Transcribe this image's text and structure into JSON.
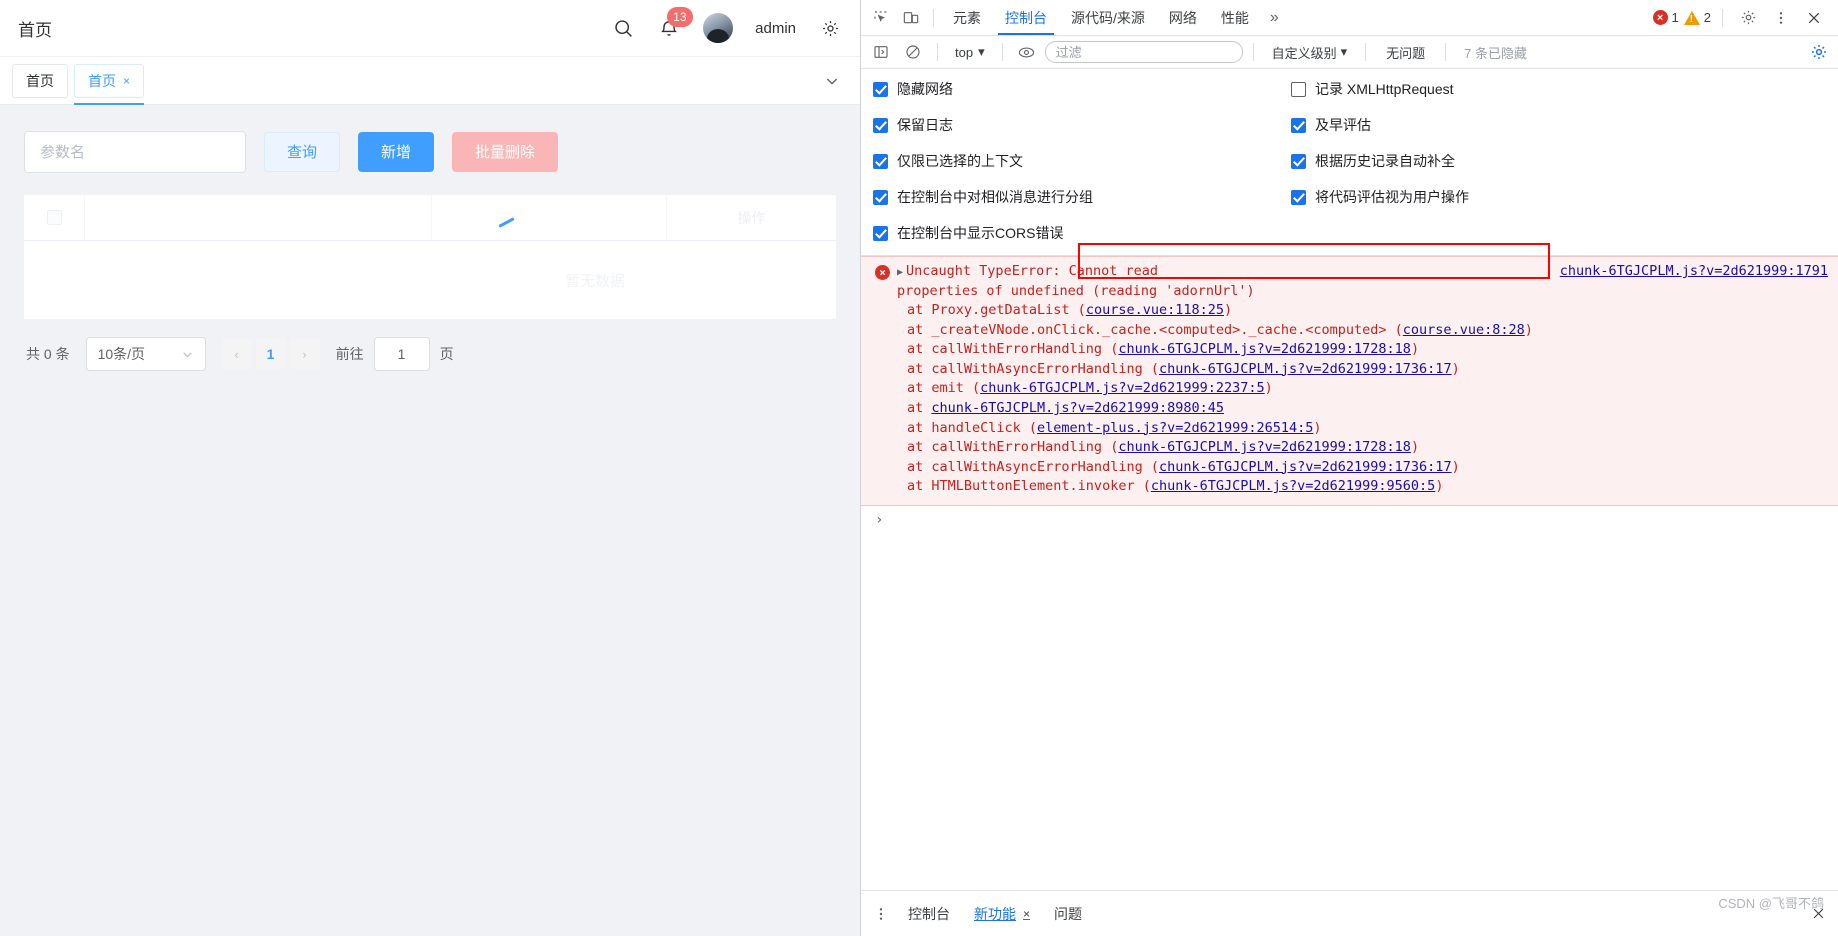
{
  "app": {
    "title": "首页",
    "topbar": {
      "search_icon": "search-icon",
      "bell_icon": "bell-icon",
      "notification_count": "13",
      "user_name": "admin",
      "settings_icon": "gear-icon"
    },
    "tabs": [
      {
        "label": "首页",
        "active": false,
        "closable": false
      },
      {
        "label": "首页",
        "active": true,
        "closable": true,
        "close": "×"
      }
    ],
    "tabs_collapse_icon": "chevron-down-icon",
    "filters": {
      "param_placeholder": "参数名",
      "param_value": "",
      "query_label": "查询",
      "add_label": "新增",
      "batch_delete_label": "批量删除"
    },
    "table": {
      "operation_column": "操作",
      "empty_text": "暂无数据"
    },
    "pagination": {
      "total_text": "共 0 条",
      "page_size": "10条/页",
      "prev": "‹",
      "current_page": "1",
      "next": "›",
      "jump_label": "前往",
      "jump_value": "1",
      "page_unit": "页"
    }
  },
  "devtools": {
    "toolbar": {
      "inspect_icon": "inspect-element-icon",
      "device_icon": "device-toolbar-icon",
      "tabs": [
        {
          "label": "元素",
          "active": false
        },
        {
          "label": "控制台",
          "active": true
        },
        {
          "label": "源代码/来源",
          "active": false
        },
        {
          "label": "网络",
          "active": false
        },
        {
          "label": "性能",
          "active": false
        }
      ],
      "more_tabs": "»",
      "error_count": "1",
      "warning_count": "2",
      "settings_icon": "gear-icon",
      "kebab_icon": "more-vertical-icon",
      "close_icon": "close-icon"
    },
    "filterbar": {
      "sidebar_icon": "console-sidebar-icon",
      "clear_icon": "clear-console-icon",
      "context": "top",
      "context_caret": "▾",
      "eye_icon": "live-expression-icon",
      "filter_placeholder": "过滤",
      "filter_value": "",
      "level": "自定义级别",
      "level_caret": "▾",
      "issues_status": "无问题",
      "hidden_count": "7 条已隐藏",
      "settings_gear": "gear-icon"
    },
    "settings": [
      {
        "label": "隐藏网络",
        "checked": true
      },
      {
        "label": "记录 XMLHttpRequest",
        "checked": false
      },
      {
        "label": "保留日志",
        "checked": true
      },
      {
        "label": "及早评估",
        "checked": true
      },
      {
        "label": "仅限已选择的上下文",
        "checked": true
      },
      {
        "label": "根据历史记录自动补全",
        "checked": true
      },
      {
        "label": "在控制台中对相似消息进行分组",
        "checked": true
      },
      {
        "label": "将代码评估视为用户操作",
        "checked": true
      },
      {
        "label": "在控制台中显示CORS错误",
        "checked": true
      }
    ],
    "error": {
      "expand_arrow": "▶",
      "prefix": "Uncaught TypeError:",
      "message_part1": "Cannot read",
      "message_part2": "properties of undefined (reading 'adornUrl')",
      "source_link": "chunk-6TGJCPLM.js?v=2d621999:1791",
      "stack": [
        {
          "text": "at Proxy.getDataList (",
          "link": "course.vue:118:25",
          "tail": ")"
        },
        {
          "text": "at _createVNode.onClick._cache.<computed>._cache.<computed> (",
          "link": "course.vue:8:28",
          "tail": ")"
        },
        {
          "text": "at callWithErrorHandling (",
          "link": "chunk-6TGJCPLM.js?v=2d621999:1728:18",
          "tail": ")"
        },
        {
          "text": "at callWithAsyncErrorHandling (",
          "link": "chunk-6TGJCPLM.js?v=2d621999:1736:17",
          "tail": ")"
        },
        {
          "text": "at emit (",
          "link": "chunk-6TGJCPLM.js?v=2d621999:2237:5",
          "tail": ")"
        },
        {
          "text": "at ",
          "link": "chunk-6TGJCPLM.js?v=2d621999:8980:45",
          "tail": ""
        },
        {
          "text": "at handleClick (",
          "link": "element-plus.js?v=2d621999:26514:5",
          "tail": ")"
        },
        {
          "text": "at callWithErrorHandling (",
          "link": "chunk-6TGJCPLM.js?v=2d621999:1728:18",
          "tail": ")"
        },
        {
          "text": "at callWithAsyncErrorHandling (",
          "link": "chunk-6TGJCPLM.js?v=2d621999:1736:17",
          "tail": ")"
        },
        {
          "text": "at HTMLButtonElement.invoker (",
          "link": "chunk-6TGJCPLM.js?v=2d621999:9560:5",
          "tail": ")"
        }
      ]
    },
    "prompt_caret": "›",
    "drawer": {
      "kebab_icon": "more-vertical-icon",
      "tabs": [
        {
          "label": "控制台",
          "active": false,
          "closable": false
        },
        {
          "label": "新功能",
          "active": true,
          "closable": true,
          "close": "×"
        },
        {
          "label": "问题",
          "active": false,
          "closable": false
        }
      ],
      "close_icon": "close-icon"
    }
  },
  "watermark": "CSDN @飞哥不鸽",
  "colors": {
    "accent_blue": "#409eff",
    "devtools_blue": "#1a73e8",
    "error_red": "#d93025",
    "warning_orange": "#f29900",
    "highlight_box": "#ff0000"
  }
}
